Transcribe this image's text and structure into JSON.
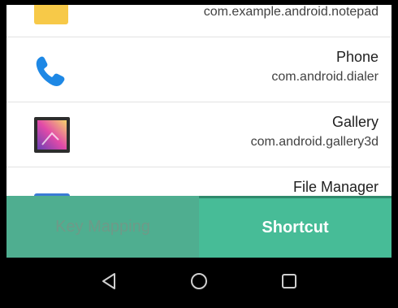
{
  "apps": [
    {
      "name": "",
      "package": "com.example.android.notepad",
      "icon": "notepad-icon"
    },
    {
      "name": "Phone",
      "package": "com.android.dialer",
      "icon": "phone-icon"
    },
    {
      "name": "Gallery",
      "package": "com.android.gallery3d",
      "icon": "gallery-icon"
    },
    {
      "name": "File Manager",
      "package": "",
      "icon": "folder-icon"
    }
  ],
  "tabs": {
    "left_label": "Key Mapping",
    "right_label": "Shortcut"
  },
  "nav": {
    "back": "back-icon",
    "home": "home-icon",
    "recents": "recents-icon"
  },
  "colors": {
    "tab_left_bg": "#4fae90",
    "tab_right_bg": "#47bc97",
    "phone_blue": "#1e88e5"
  }
}
